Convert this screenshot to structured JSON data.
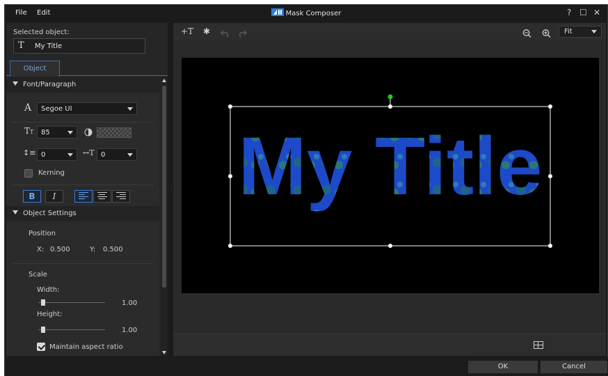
{
  "window": {
    "title": "Mask Composer",
    "menu": [
      "File",
      "Edit"
    ],
    "help_label": "?",
    "maximize_label": "☐",
    "close_label": "✕"
  },
  "left_panel": {
    "selected_object_label": "Selected object:",
    "selected_object_value": "My Title",
    "tab_label": "Object",
    "font_section": {
      "header": "Font/Paragraph",
      "font_name": "Segoe UI",
      "font_size": "85",
      "line_spacing": "0",
      "char_spacing": "0",
      "kerning_label": "Kerning",
      "kerning_checked": false,
      "bold_label": "B",
      "italic_label": "I"
    },
    "object_section": {
      "header": "Object Settings",
      "position_label": "Position",
      "x_label": "X:",
      "x_value": "0.500",
      "y_label": "Y:",
      "y_value": "0.500",
      "scale_label": "Scale",
      "width_label": "Width:",
      "width_value": "1.00",
      "height_label": "Height:",
      "height_value": "1.00",
      "aspect_label": "Maintain aspect ratio",
      "aspect_checked": true
    }
  },
  "toolbar": {
    "insert_text_icon": "+T",
    "insert_particle_icon": "✱",
    "undo_icon": "undo",
    "redo_icon": "redo",
    "zoom_out_icon": "zoom-out",
    "zoom_in_icon": "zoom-in",
    "zoom_value": "Fit"
  },
  "canvas": {
    "title_text": "My Title",
    "text_color": "#1f4fd0"
  },
  "footer": {
    "ok_label": "OK",
    "cancel_label": "Cancel"
  }
}
